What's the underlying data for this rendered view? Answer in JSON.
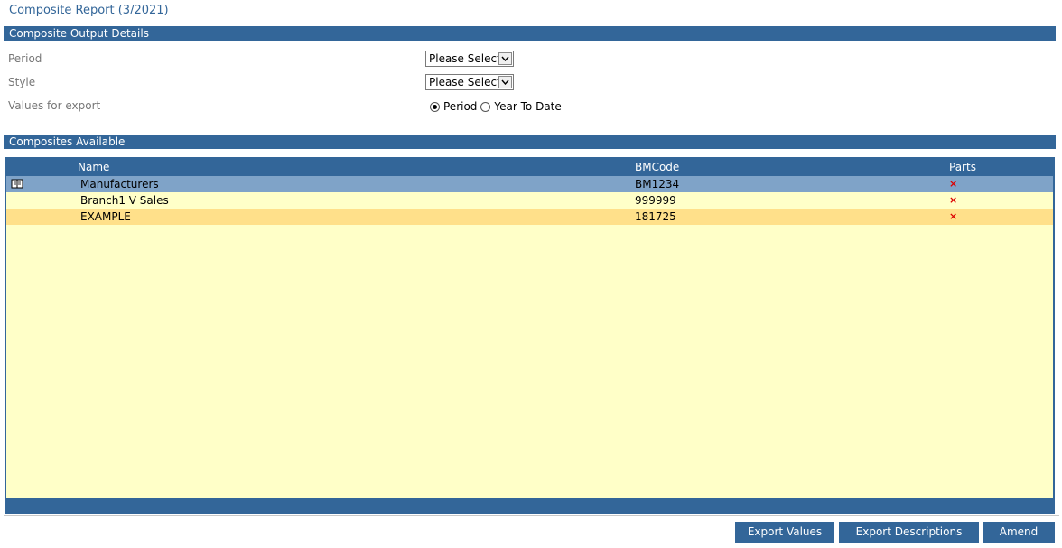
{
  "page": {
    "title": "Composite Report (3/2021)"
  },
  "output_details": {
    "header": "Composite Output Details",
    "period_label": "Period",
    "period_value": "Please Select.",
    "style_label": "Style",
    "style_value": "Please Select.",
    "values_label": "Values for export",
    "radio_period": "Period",
    "radio_ytd": "Year To Date",
    "selected": "Period"
  },
  "composites": {
    "header": "Composites Available",
    "columns": {
      "name": "Name",
      "bmcode": "BMCode",
      "parts": "Parts"
    },
    "rows": [
      {
        "name": "Manufacturers",
        "bmcode": "BM1234",
        "parts": "×",
        "selected": true
      },
      {
        "name": "Branch1 V Sales",
        "bmcode": "999999",
        "parts": "×",
        "selected": false
      },
      {
        "name": "EXAMPLE",
        "bmcode": "181725",
        "parts": "×",
        "selected": false
      }
    ],
    "colors": {
      "selected": "#7fa3c8",
      "alt": "#ffe08a",
      "base": "#ffffc8"
    }
  },
  "buttons": {
    "export_values": "Export Values",
    "export_descriptions": "Export Descriptions",
    "amend": "Amend"
  },
  "icons": {
    "row_icon": "book-icon",
    "delete_icon": "red-x-icon",
    "dropdown_icon": "chevron-down-icon"
  }
}
